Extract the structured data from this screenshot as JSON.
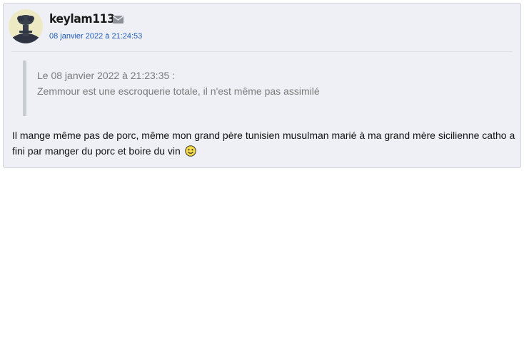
{
  "post": {
    "author": "keylam113",
    "date": "08 janvier 2022 à 21:24:53",
    "quote": {
      "header": "Le 08 janvier 2022 à 21:23:35 :",
      "text": "Zemmour est une escroquerie totale, il n'est même pas assimilé"
    },
    "body": "Il mange même pas de porc, même mon grand père tunisien musulman marié à ma grand mère sicilienne catho a fini par manger du porc et boire du vin",
    "smiley_name": "sourire-smiley-icon",
    "mail_icon": "envelope-icon"
  }
}
